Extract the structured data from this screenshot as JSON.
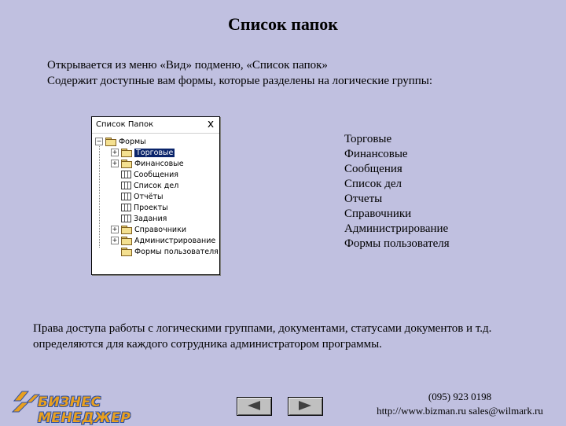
{
  "title": "Список папок",
  "intro": {
    "line1": "Открывается из меню «Вид» подменю, «Список папок»",
    "line2": "Содержит доступные вам формы, которые разделены на логические группы:"
  },
  "panel": {
    "title": "Список Папок",
    "close": "x",
    "tree": [
      {
        "label": "Формы",
        "type": "folder",
        "expander": "−"
      },
      {
        "label": "Торговые",
        "type": "folder",
        "expander": "+",
        "selected": true
      },
      {
        "label": "Финансовые",
        "type": "folder",
        "expander": "+"
      },
      {
        "label": "Сообщения",
        "type": "form"
      },
      {
        "label": "Список дел",
        "type": "form"
      },
      {
        "label": "Отчёты",
        "type": "form"
      },
      {
        "label": "Проекты",
        "type": "form"
      },
      {
        "label": "Задания",
        "type": "form"
      },
      {
        "label": "Справочники",
        "type": "folder",
        "expander": "+"
      },
      {
        "label": "Администрирование",
        "type": "folder",
        "expander": "+"
      },
      {
        "label": "Формы пользователя",
        "type": "folder"
      }
    ]
  },
  "groups": [
    "Торговые",
    "Финансовые",
    "Сообщения",
    "Список дел",
    "Отчеты",
    "Справочники",
    "Администрирование",
    "Формы пользователя"
  ],
  "note": {
    "line1": "Права доступа работы с логическими группами, документами,  статусами документов и т.д.",
    "line2": "определяются для каждого сотрудника администратором программы."
  },
  "logo": {
    "text": "БИЗНЕС МЕНЕДЖЕР"
  },
  "contact": {
    "phone": "(095) 923 0198",
    "web": "http://www.bizman.ru  sales@wilmark.ru"
  },
  "colors": {
    "background": "#c0c0e0",
    "selection": "#0a246a",
    "logo": "#e8a020"
  }
}
